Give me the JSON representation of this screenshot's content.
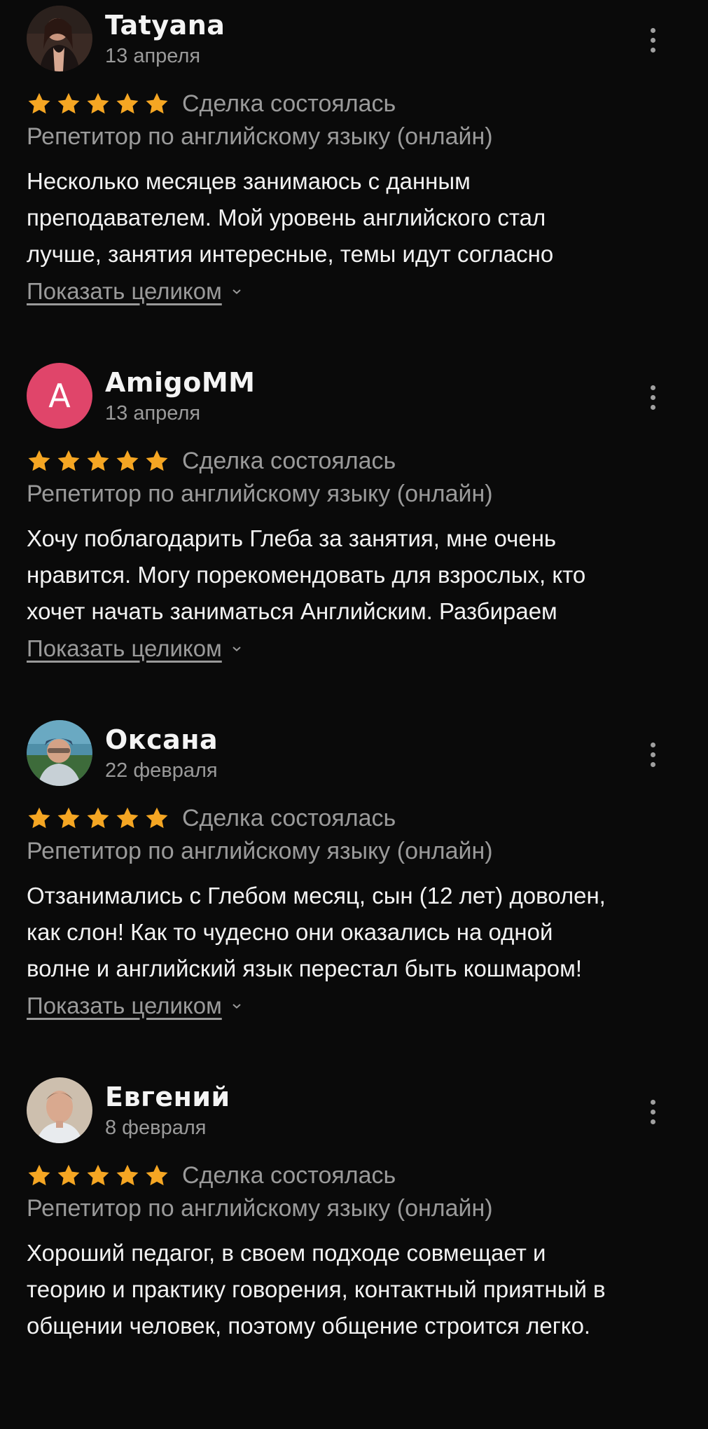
{
  "colors": {
    "background": "#0a0a0a",
    "star": "#f5a623",
    "muted_text": "#9a9a9a",
    "primary_text": "#f2f2f2",
    "letter_avatar_bg": "#e0456a"
  },
  "reviews": [
    {
      "author": "Tatyana",
      "date": "13 апреля",
      "avatar": "photo-avatar",
      "rating": 5,
      "deal_status": "Сделка состоялась",
      "service": "Репетитор по английскому языку (онлайн)",
      "text_lines": [
        "Несколько месяцев занимаюсь с данным",
        "преподавателем. Мой уровень английского стал",
        "лучше, занятия интересные, темы идут согласно"
      ],
      "expand_label": "Показать целиком"
    },
    {
      "author": "AmigoMM",
      "date": "13 апреля",
      "avatar": "letter-avatar",
      "avatar_letter": "A",
      "rating": 5,
      "deal_status": "Сделка состоялась",
      "service": "Репетитор по английскому языку (онлайн)",
      "text_lines": [
        "Хочу поблагодарить Глеба за занятия, мне очень",
        "нравится. Могу порекомендовать для взрослых, кто",
        "хочет начать заниматься Английским. Разбираем"
      ],
      "expand_label": "Показать целиком"
    },
    {
      "author": "Оксана",
      "date": "22 февраля",
      "avatar": "photo-avatar",
      "rating": 5,
      "deal_status": "Сделка состоялась",
      "service": "Репетитор по английскому языку (онлайн)",
      "text_lines": [
        "Отзанимались с Глебом месяц, сын (12 лет)  доволен,",
        "как слон!  Как то чудесно они оказались на одной",
        "волне и английский язык перестал быть кошмаром!"
      ],
      "expand_label": "Показать целиком"
    },
    {
      "author": "Евгений",
      "date": "8 февраля",
      "avatar": "photo-avatar",
      "rating": 5,
      "deal_status": "Сделка состоялась",
      "service": "Репетитор по английскому языку (онлайн)",
      "text_lines": [
        "Хороший педагог, в своем подходе совмещает и",
        "теорию и практику говорения, контактный приятный в",
        "общении человек, поэтому общение строится легко."
      ],
      "expand_label": ""
    }
  ]
}
